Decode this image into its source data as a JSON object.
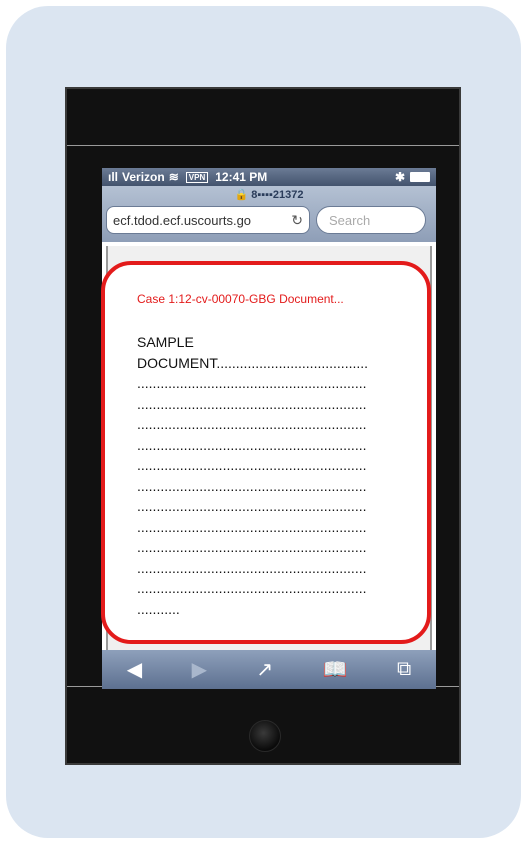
{
  "status_bar": {
    "carrier": "Verizon",
    "vpn": "VPN",
    "time": "12:41 PM"
  },
  "browser": {
    "page_title": "8▪▪▪▪21372",
    "url": "ecf.tdod.ecf.uscourts.go",
    "search_placeholder": "Search"
  },
  "document": {
    "title": "Case 1:12-cv-00070-GBG Document...",
    "lines": [
      "SAMPLE",
      "DOCUMENT.......................................",
      "...........................................................",
      "...........................................................",
      "...........................................................",
      "...........................................................",
      "...........................................................",
      "...........................................................",
      "...........................................................",
      "...........................................................",
      "...........................................................",
      "...........................................................",
      "...........................................................",
      "..........."
    ]
  },
  "toolbar": {
    "back": "◀",
    "forward": "▶",
    "share": "↗",
    "bookmarks": "📖",
    "tabs": "⧉"
  },
  "colors": {
    "background_card": "#dbe5f1",
    "highlight": "#e31b1b",
    "phone_body": "#111111"
  }
}
